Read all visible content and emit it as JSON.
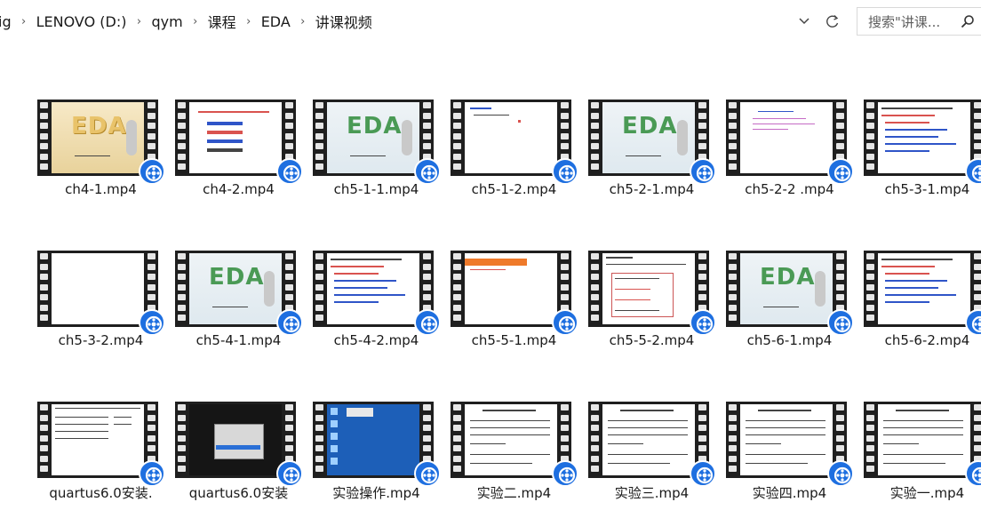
{
  "breadcrumb": {
    "partial": "ig",
    "items": [
      "LENOVO (D:)",
      "qym",
      "课程",
      "EDA",
      "讲课视频"
    ],
    "separator": "›"
  },
  "search": {
    "placeholder": "搜索\"讲课..."
  },
  "toolbar": {
    "dropdown_icon": "chevron-down-icon",
    "refresh_icon": "refresh-icon"
  },
  "colors": {
    "badge": "#1e6fe0",
    "film": "#1f1f1f",
    "eda_green": "#4a9a55"
  },
  "files": [
    {
      "name": "ch4-1.mp4",
      "thumb": "eda-yellow"
    },
    {
      "name": "ch4-2.mp4",
      "thumb": "slide-colored"
    },
    {
      "name": "ch5-1-1.mp4",
      "thumb": "eda"
    },
    {
      "name": "ch5-1-2.mp4",
      "thumb": "doc-sparse"
    },
    {
      "name": "ch5-2-1.mp4",
      "thumb": "eda"
    },
    {
      "name": "ch5-2-2 .mp4",
      "thumb": "doc-purple"
    },
    {
      "name": "ch5-3-1.mp4",
      "thumb": "doc-redblue"
    },
    {
      "name": "ch5-3-2.mp4",
      "thumb": "blank"
    },
    {
      "name": "ch5-4-1.mp4",
      "thumb": "eda"
    },
    {
      "name": "ch5-4-2.mp4",
      "thumb": "doc-redblue"
    },
    {
      "name": "ch5-5-1.mp4",
      "thumb": "doc-orange"
    },
    {
      "name": "ch5-5-2.mp4",
      "thumb": "doc-boxed"
    },
    {
      "name": "ch5-6-1.mp4",
      "thumb": "eda"
    },
    {
      "name": "ch5-6-2.mp4",
      "thumb": "doc-redblue"
    },
    {
      "name": "quartus6.0安装.",
      "thumb": "doc-table"
    },
    {
      "name": "quartus6.0安装",
      "thumb": "dark-dialog"
    },
    {
      "name": "实验操作.mp4",
      "thumb": "desktop"
    },
    {
      "name": "实验二.mp4",
      "thumb": "doc-lines"
    },
    {
      "name": "实验三.mp4",
      "thumb": "doc-lines"
    },
    {
      "name": "实验四.mp4",
      "thumb": "doc-lines"
    },
    {
      "name": "实验一.mp4",
      "thumb": "doc-lines"
    }
  ]
}
